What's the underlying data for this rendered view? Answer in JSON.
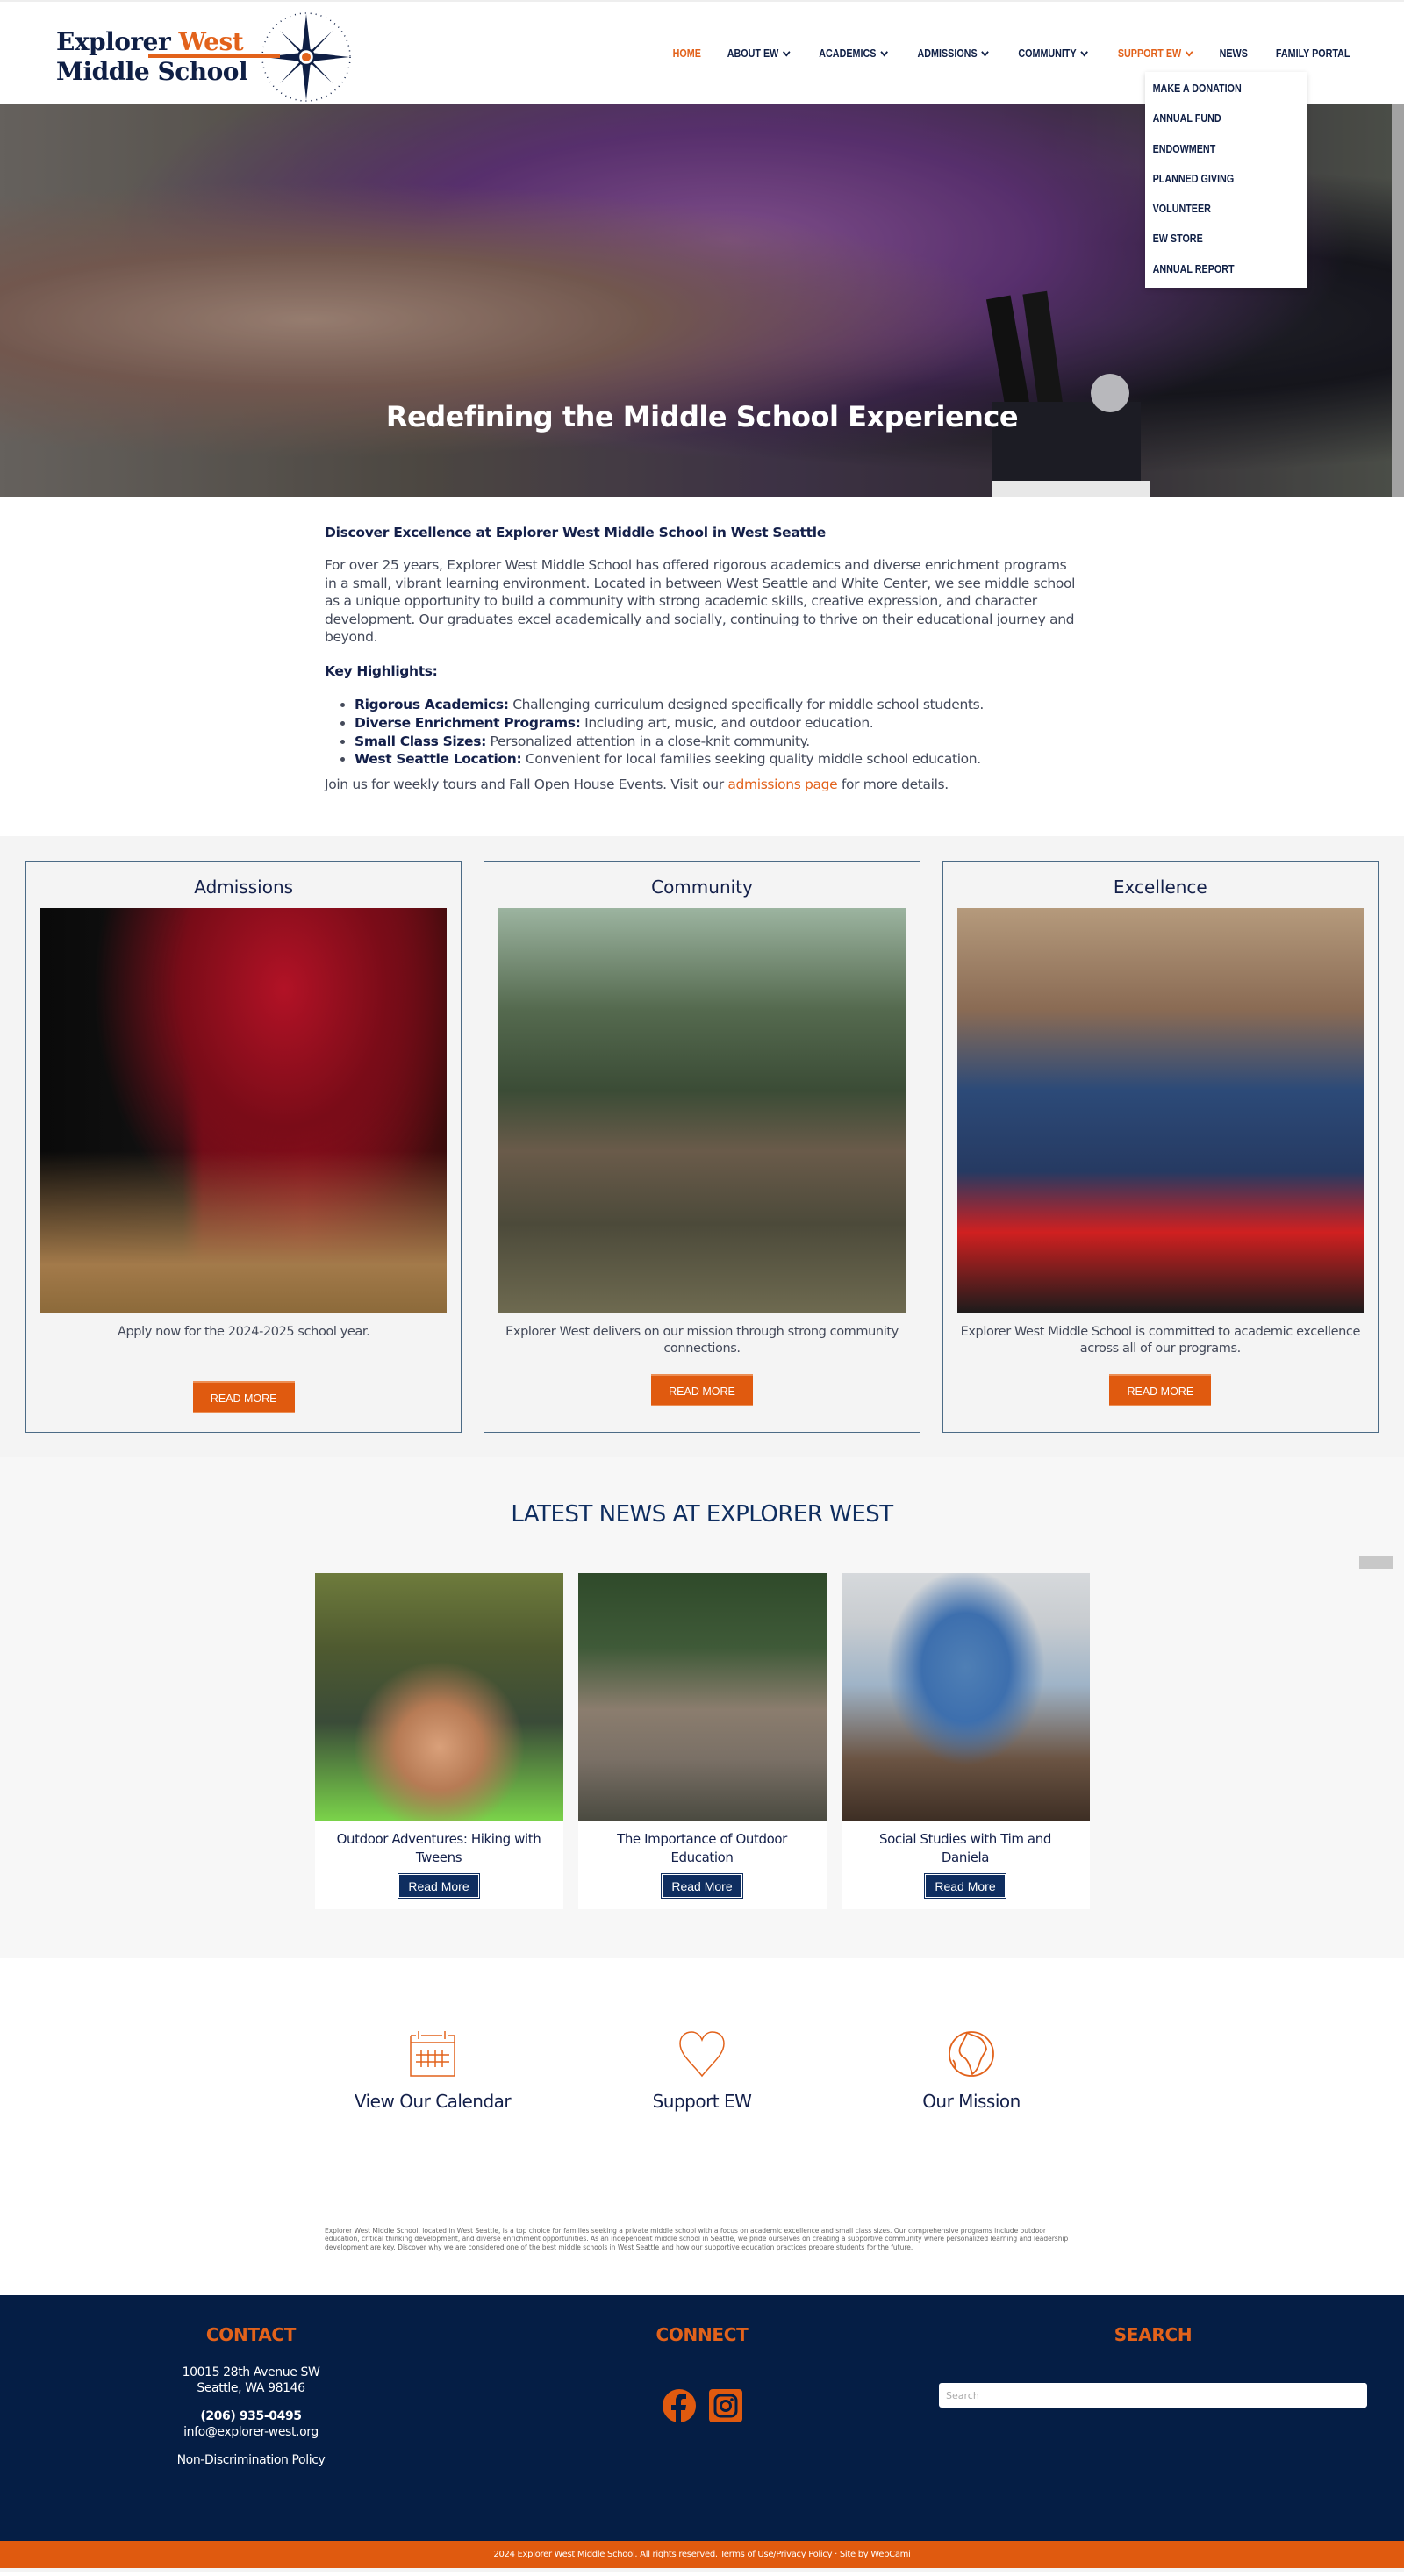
{
  "header": {
    "logo": {
      "line1_a": "Explorer ",
      "line1_b": "West",
      "line2": "Middle School"
    },
    "nav": [
      {
        "label": "HOME",
        "active": true,
        "dropdown": false
      },
      {
        "label": "ABOUT EW",
        "active": false,
        "dropdown": true
      },
      {
        "label": "ACADEMICS",
        "active": false,
        "dropdown": true
      },
      {
        "label": "ADMISSIONS",
        "active": false,
        "dropdown": true
      },
      {
        "label": "COMMUNITY",
        "active": false,
        "dropdown": true
      },
      {
        "label": "SUPPORT EW",
        "active": true,
        "dropdown": true
      },
      {
        "label": "NEWS",
        "active": false,
        "dropdown": false
      },
      {
        "label": "FAMILY PORTAL",
        "active": false,
        "dropdown": false
      }
    ],
    "support_dropdown": [
      "MAKE A DONATION",
      "ANNUAL FUND",
      "ENDOWMENT",
      "PLANNED GIVING",
      "VOLUNTEER",
      "EW STORE",
      "ANNUAL REPORT"
    ]
  },
  "hero": {
    "title": "Redefining the Middle School Experience"
  },
  "intro": {
    "heading": "Discover Excellence at Explorer West Middle School in West Seattle",
    "paragraph": "For over 25 years, Explorer West Middle School has offered rigorous academics and diverse enrichment programs in a small, vibrant learning environment. Located in between West Seattle and White Center, we see middle school as a unique opportunity to build a community with strong academic skills, creative expression, and character development. Our graduates excel academically and socially, continuing to thrive on their educational journey and beyond.",
    "highlights_heading": "Key Highlights:",
    "highlights": [
      {
        "title": "Rigorous Academics:",
        "text": " Challenging curriculum designed specifically for middle school students."
      },
      {
        "title": "Diverse Enrichment Programs:",
        "text": " Including art, music, and outdoor education."
      },
      {
        "title": "Small Class Sizes:",
        "text": " Personalized attention in a close-knit community."
      },
      {
        "title": "West Seattle Location:",
        "text": " Convenient for local families seeking quality middle school education."
      }
    ],
    "cta_before": "Join us for weekly tours and Fall Open House Events. Visit our ",
    "cta_link": "admissions page",
    "cta_after": " for more details."
  },
  "cards": [
    {
      "title": "Admissions",
      "text": "Apply now for the 2024-2025 school year.",
      "button": "READ MORE",
      "image": "student band concert"
    },
    {
      "title": "Community",
      "text": "Explorer West delivers on our mission through strong community connections.",
      "button": "READ MORE",
      "image": "students on forest bridge"
    },
    {
      "title": "Excellence",
      "text": "Explorer West Middle School is committed to academic excellence across all of our programs.",
      "button": "READ MORE",
      "image": "students doing science experiment"
    }
  ],
  "news": {
    "heading": "LATEST NEWS AT EXPLORER WEST",
    "items": [
      {
        "title": "Outdoor Adventures: Hiking with Tweens",
        "button": "Read More"
      },
      {
        "title": "The Importance of Outdoor Education",
        "button": "Read More"
      },
      {
        "title": "Social Studies with Tim and Daniela",
        "button": "Read More"
      }
    ]
  },
  "quick_links": [
    {
      "icon": "calendar-icon",
      "label": "View Our Calendar"
    },
    {
      "icon": "heart-icon",
      "label": "Support EW"
    },
    {
      "icon": "globe-icon",
      "label": "Our Mission"
    }
  ],
  "seo_text": "Explorer West Middle School, located in West Seattle, is a top choice for families seeking a private middle school with a focus on academic excellence and small class sizes. Our comprehensive programs include outdoor education, critical thinking development, and diverse enrichment opportunities. As an independent middle school in Seattle, we pride ourselves on creating a supportive community where personalized learning and leadership development are key. Discover why we are considered one of the best middle schools in West Seattle and how our supportive education practices prepare students for the future.",
  "footer": {
    "contact": {
      "heading": "CONTACT",
      "address1": "10015 28th Avenue SW",
      "address2": "Seattle, WA 98146",
      "phone": "(206) 935-0495",
      "email": "info@explorer-west.org",
      "policy": "Non-Discrimination Policy"
    },
    "connect": {
      "heading": "CONNECT",
      "icons": [
        "facebook-icon",
        "instagram-icon"
      ]
    },
    "search": {
      "heading": "SEARCH",
      "placeholder": "Search"
    },
    "copyright": "2024 Explorer West Middle School. All rights reserved.",
    "terms": "Terms of Use/Privacy Policy",
    "separator": " · ",
    "credit": "Site by WebCami"
  },
  "colors": {
    "accent": "#e2621b",
    "navy": "#0f2e60",
    "footer_bg": "#051e45",
    "text_dark": "#14204a"
  }
}
